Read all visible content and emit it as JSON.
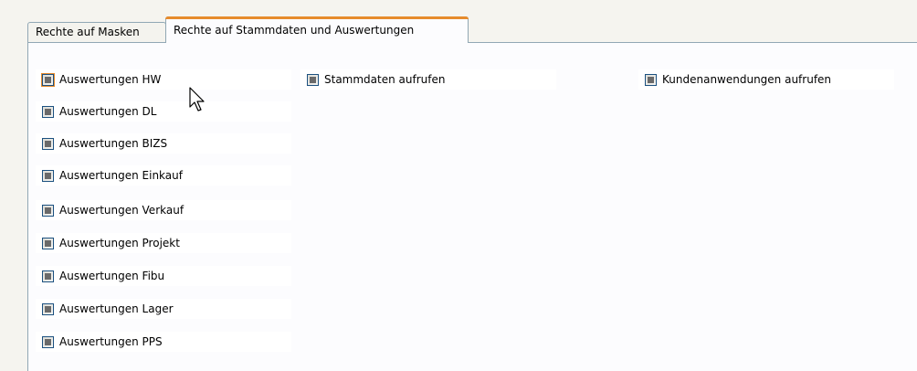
{
  "tabs": [
    {
      "label": "Rechte auf Masken",
      "active": false
    },
    {
      "label": "Rechte auf Stammdaten und Auswertungen",
      "active": true
    }
  ],
  "column1": [
    {
      "label": "Auswertungen HW",
      "state": "indeterminate"
    },
    {
      "label": "Auswertungen DL",
      "state": "indeterminate"
    },
    {
      "label": "Auswertungen BIZS",
      "state": "indeterminate"
    },
    {
      "label": "Auswertungen Einkauf",
      "state": "indeterminate"
    },
    {
      "label": "Auswertungen Verkauf",
      "state": "indeterminate"
    },
    {
      "label": "Auswertungen Projekt",
      "state": "indeterminate"
    },
    {
      "label": "Auswertungen Fibu",
      "state": "indeterminate"
    },
    {
      "label": "Auswertungen Lager",
      "state": "indeterminate"
    },
    {
      "label": "Auswertungen PPS",
      "state": "indeterminate"
    }
  ],
  "column2": [
    {
      "label": "Stammdaten aufrufen",
      "state": "indeterminate"
    }
  ],
  "column3": [
    {
      "label": "Kundenanwendungen aufrufen",
      "state": "indeterminate"
    }
  ],
  "colors": {
    "background": "#f5f4ef",
    "panel": "#fcfcfe",
    "tab_border": "#91a7b4",
    "active_tab_highlight": "#e68b2c",
    "checkbox_border": "#1c5180",
    "checkbox_mark": "#6a6a6a"
  },
  "icons": {
    "cursor": "mouse-pointer-icon"
  }
}
